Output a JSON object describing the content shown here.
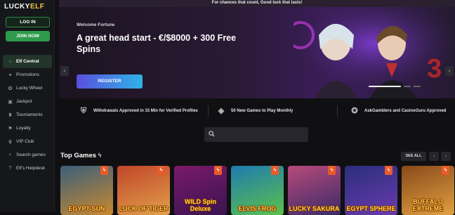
{
  "topbar": {
    "text": "For chances that count, Good luck that lasts!"
  },
  "logo": {
    "part1": "LUCKY",
    "part2": "ELF"
  },
  "auth": {
    "login_label": "LOG IN",
    "join_label": "JOIN NOW"
  },
  "sidebar": {
    "items": [
      {
        "label": "Elf Central",
        "icon": "home-icon",
        "glyph": "⌂"
      },
      {
        "label": "Promotions",
        "icon": "gift-icon",
        "glyph": "✦"
      },
      {
        "label": "Lucky Wheel",
        "icon": "wheel-icon",
        "glyph": "✪"
      },
      {
        "label": "Jackpot",
        "icon": "jackpot-icon",
        "glyph": "▣"
      },
      {
        "label": "Tournaments",
        "icon": "trophy-icon",
        "glyph": "♜"
      },
      {
        "label": "Loyalty",
        "icon": "flag-icon",
        "glyph": "⚑"
      },
      {
        "label": "VIP Club",
        "icon": "crown-icon",
        "glyph": "♛"
      },
      {
        "label": "Search games",
        "icon": "search-icon",
        "glyph": "⌕"
      },
      {
        "label": "Elf's Helpdesk",
        "icon": "help-icon",
        "glyph": "?"
      }
    ]
  },
  "hero": {
    "welcome": "Welcome Fortune",
    "headline": "A great head start - €/$8000 + 300 Free Spins",
    "register_label": "REGISTER"
  },
  "perks": [
    {
      "text": "Withdrawals Approved in 15 Min for Verified Profiles",
      "icon": "shield-icon"
    },
    {
      "text": "50 New Games to Play Monthly",
      "icon": "dice-icon"
    },
    {
      "text": "AskGamblers and CasinoGuru Approved",
      "icon": "badge-icon"
    }
  ],
  "search": {
    "placeholder": ""
  },
  "games": {
    "title": "Top Games",
    "see_all_label": "SEE ALL",
    "tiles": [
      {
        "name": "EGYPT SUN",
        "bg": "#3a5f7a",
        "bg2": "#c9892f"
      },
      {
        "name": "LUCK OF TIGER",
        "bg": "#c2452a",
        "bg2": "#e0a14a"
      },
      {
        "name": "WILD Spin Deluxe",
        "bg": "#7a1a6a",
        "bg2": "#3a1450"
      },
      {
        "name": "ELVIS FROG",
        "bg": "#1f7ab0",
        "bg2": "#5cc24a"
      },
      {
        "name": "LUCKY SAKURA",
        "bg": "#b84a7a",
        "bg2": "#3a2a6a"
      },
      {
        "name": "EGYPT SPHERE",
        "bg": "#2a2f7a",
        "bg2": "#6a3ab0"
      },
      {
        "name": "BUFFALO EXTREME",
        "bg": "#8a4a1a",
        "bg2": "#e0a040"
      }
    ]
  },
  "colors": {
    "accent_green": "#2e9a4c",
    "badge_orange": "#e85a2a"
  }
}
